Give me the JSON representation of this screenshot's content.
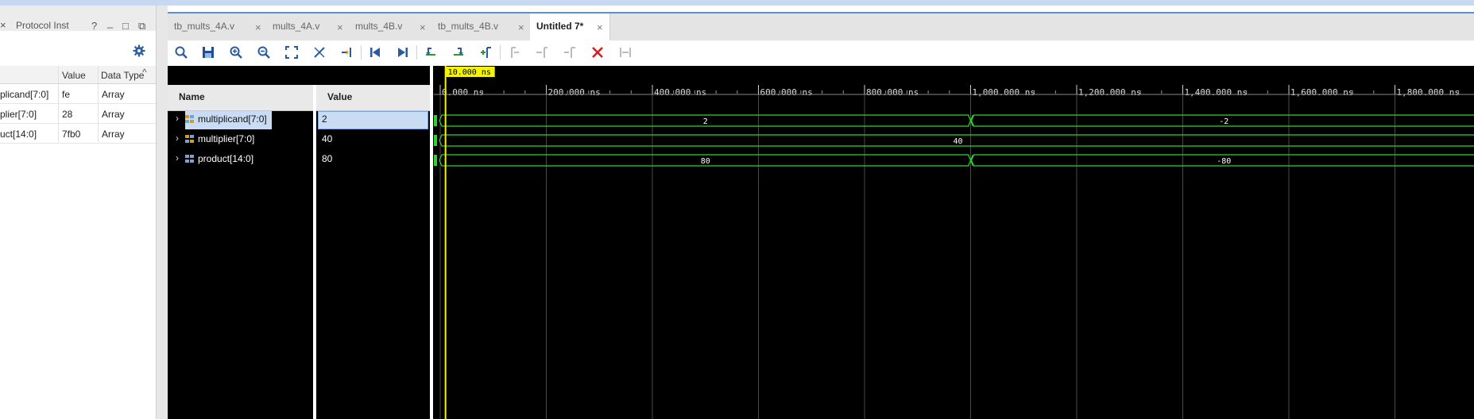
{
  "left_panel": {
    "tab_label": "Protocol Inst",
    "help": "?",
    "minimize": "_",
    "maximize": "□",
    "restore": "⧉",
    "columns": [
      "",
      "Value",
      "Data Type"
    ],
    "rows": [
      {
        "name": "plicand[7:0]",
        "value": "fe",
        "type": "Array"
      },
      {
        "name": "plier[7:0]",
        "value": "28",
        "type": "Array"
      },
      {
        "name": "uct[14:0]",
        "value": "7fb0",
        "type": "Array"
      }
    ]
  },
  "tabs": [
    {
      "label": "tb_mults_4A.v",
      "close": "×"
    },
    {
      "label": "mults_4A.v",
      "close": "×"
    },
    {
      "label": "mults_4B.v",
      "close": "×"
    },
    {
      "label": "tb_mults_4B.v",
      "close": "×"
    },
    {
      "label": "Untitled 7*",
      "close": "×",
      "active": true
    }
  ],
  "toolbar_icons": [
    "search-icon",
    "save-icon",
    "zoom-in-icon",
    "zoom-out-icon",
    "zoom-fit-icon",
    "cursor-snap-icon",
    "goto-cursor-icon",
    "goto-start-icon",
    "goto-end-icon",
    "prev-transition-icon",
    "next-transition-icon",
    "add-marker-icon",
    "prev-marker-icon",
    "next-marker-icon",
    "remove-marker-icon",
    "delete-icon",
    "swap-markers-icon"
  ],
  "wave": {
    "name_header": "Name",
    "value_header": "Value",
    "cursor_label": "10.000 ns",
    "time_ticks": [
      "0.000 ns",
      "200.000 ns",
      "400.000 ns",
      "600.000 ns",
      "800.000 ns",
      "1,000.000 ns",
      "1,200.000 ns",
      "1,400.000 ns",
      "1,600.000 ns",
      "1,800.000 ns"
    ],
    "signals": [
      {
        "name": "multiplicand[7:0]",
        "value": "2",
        "segments": [
          {
            "from": 0,
            "to": 1000,
            "label": "2"
          },
          {
            "from": 1000,
            "to": 2000,
            "label": "-2"
          }
        ]
      },
      {
        "name": "multiplier[7:0]",
        "value": "40",
        "segments": [
          {
            "from": 0,
            "to": 2000,
            "label": "40"
          }
        ]
      },
      {
        "name": "product[14:0]",
        "value": "80",
        "segments": [
          {
            "from": 0,
            "to": 1000,
            "label": "80"
          },
          {
            "from": 1000,
            "to": 2000,
            "label": "-80"
          }
        ]
      }
    ],
    "expand_glyph": "›",
    "colors": {
      "wave": "#2fd22f",
      "cursor": "#f4f400",
      "grid": "#4a4a4a",
      "text": "#ffffff"
    }
  }
}
